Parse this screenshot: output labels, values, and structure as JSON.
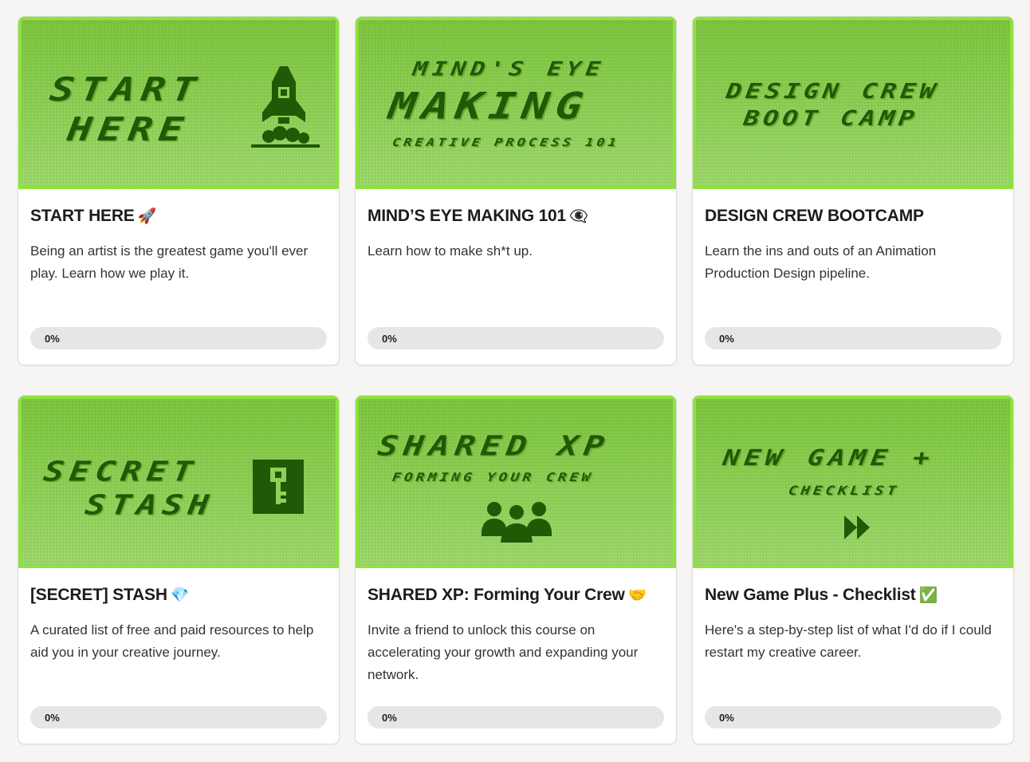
{
  "colors": {
    "thumb_green": "#8fd157",
    "pixel_dark": "#1f5a06",
    "progress_track": "#e6e6e6"
  },
  "courses": [
    {
      "thumb": {
        "line1": "START",
        "line2": "HERE",
        "icon": "rocket-icon"
      },
      "title": "START HERE",
      "emoji": "🚀",
      "description": "Being an artist is the greatest game you'll ever play. Learn how we play it.",
      "progress": 0,
      "progress_label": "0%"
    },
    {
      "thumb": {
        "line1": "MIND'S EYE",
        "line2": "MAKING",
        "line3": "CREATIVE PROCESS 101"
      },
      "title": "MIND’S EYE MAKING 101",
      "emoji": "👁‍🗨",
      "description": "Learn how to make sh*t up.",
      "progress": 0,
      "progress_label": "0%"
    },
    {
      "thumb": {
        "line1": "DESIGN CREW",
        "line2": "BOOT CAMP"
      },
      "title": "DESIGN CREW BOOTCAMP",
      "emoji": "",
      "description": "Learn the ins and outs of an Animation Production Design pipeline.",
      "progress": 0,
      "progress_label": "0%"
    },
    {
      "thumb": {
        "line1": "SECRET",
        "line2": "STASH",
        "icon": "key-icon"
      },
      "title": "[SECRET] STASH",
      "emoji": "💎",
      "description": "A curated list of free and paid resources to help aid you in your creative journey.",
      "progress": 0,
      "progress_label": "0%"
    },
    {
      "thumb": {
        "line1": "SHARED XP",
        "line2": "FORMING YOUR CREW",
        "icon": "group-icon"
      },
      "title": "SHARED XP: Forming Your Crew",
      "emoji": "🤝",
      "description": "Invite a friend to unlock this course on accelerating your growth and expanding your network.",
      "progress": 0,
      "progress_label": "0%"
    },
    {
      "thumb": {
        "line1": "NEW GAME +",
        "line2": "CHECKLIST",
        "icon": "fast-forward-icon"
      },
      "title": "New Game Plus - Checklist",
      "emoji": "✅",
      "description": "Here's a step-by-step list of what I'd do if I could restart my creative career.",
      "progress": 0,
      "progress_label": "0%"
    }
  ]
}
